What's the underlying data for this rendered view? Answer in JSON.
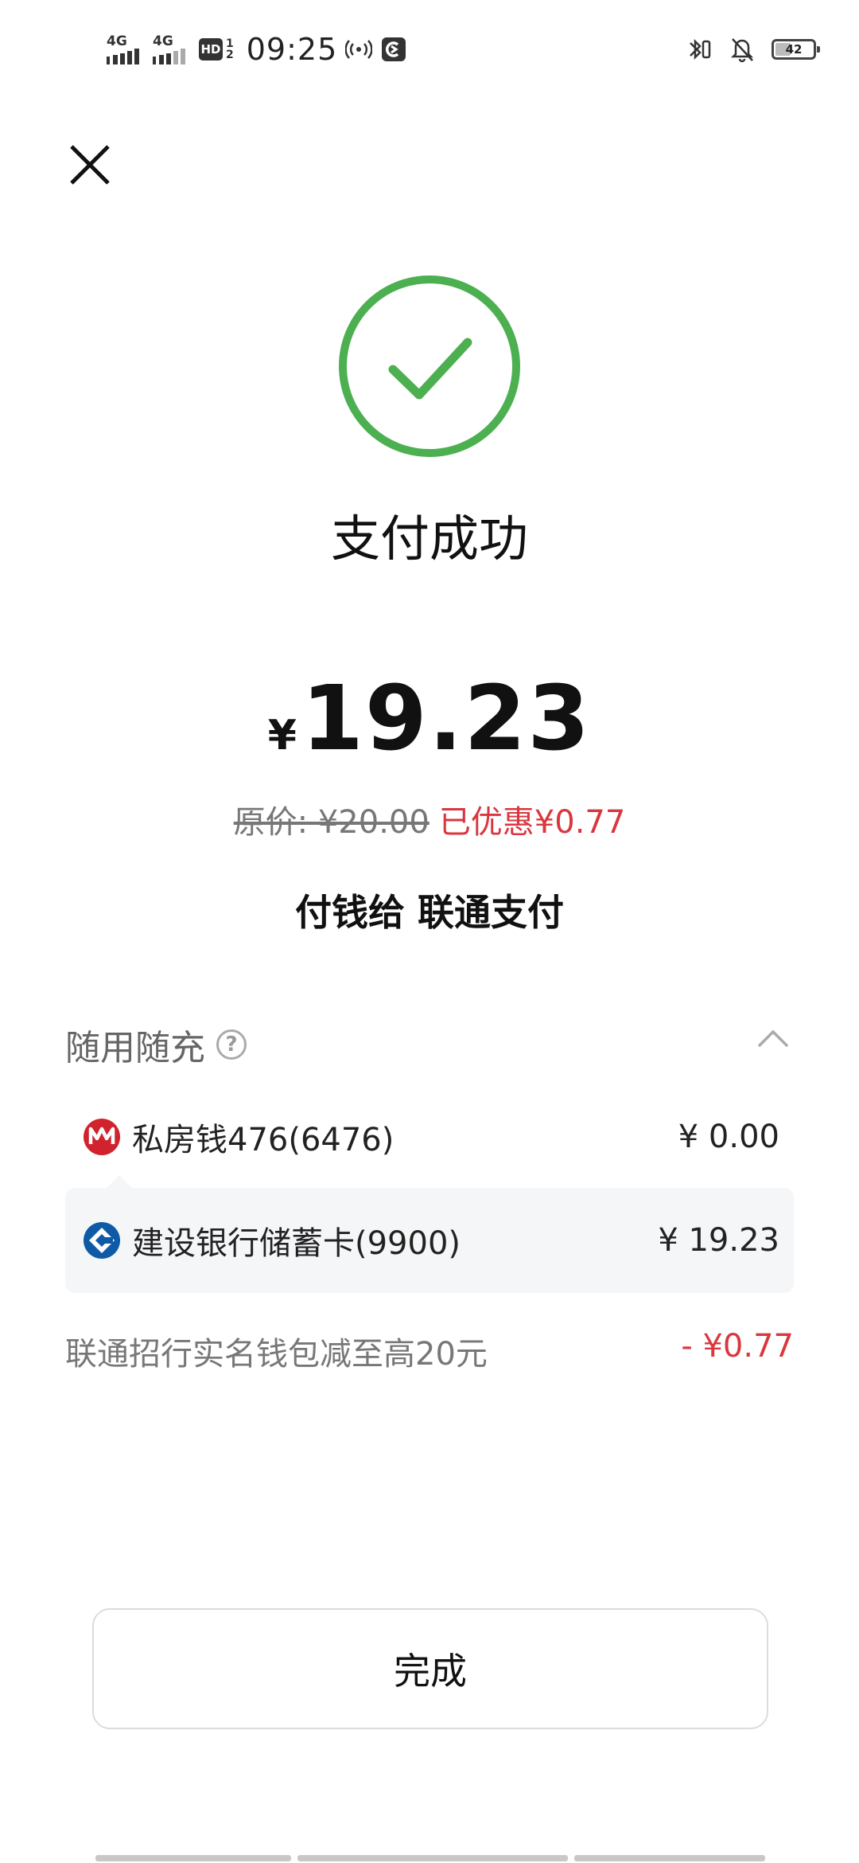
{
  "status_bar": {
    "net1": "4G",
    "net2": "4G",
    "hd": "HD",
    "hd_fraction_top": "1",
    "hd_fraction_bottom": "2",
    "time": "09:25",
    "battery": "42",
    "battery_level_percent": 42
  },
  "result": {
    "title": "支付成功",
    "currency_symbol": "¥",
    "amount": "19.23",
    "original_price": "原价: ¥20.00",
    "discount_text": "已优惠¥0.77",
    "payee": "付钱给 联通支付"
  },
  "payment_section": {
    "label": "随用随充",
    "help_glyph": "?",
    "rows": [
      {
        "icon": "cmb-bank-icon",
        "name": "私房钱476(6476)",
        "amount": "¥ 0.00"
      },
      {
        "icon": "ccb-bank-icon",
        "name": "建设银行储蓄卡(9900)",
        "amount": "¥ 19.23"
      }
    ]
  },
  "promotion": {
    "label": "联通招行实名钱包减至高20元",
    "amount": "- ¥0.77"
  },
  "done_button": {
    "label": "完成"
  },
  "colors": {
    "success_green": "#4caf50",
    "discount_red": "#d9363e",
    "cmb_red": "#d0232d",
    "ccb_blue": "#0e5aa7"
  }
}
